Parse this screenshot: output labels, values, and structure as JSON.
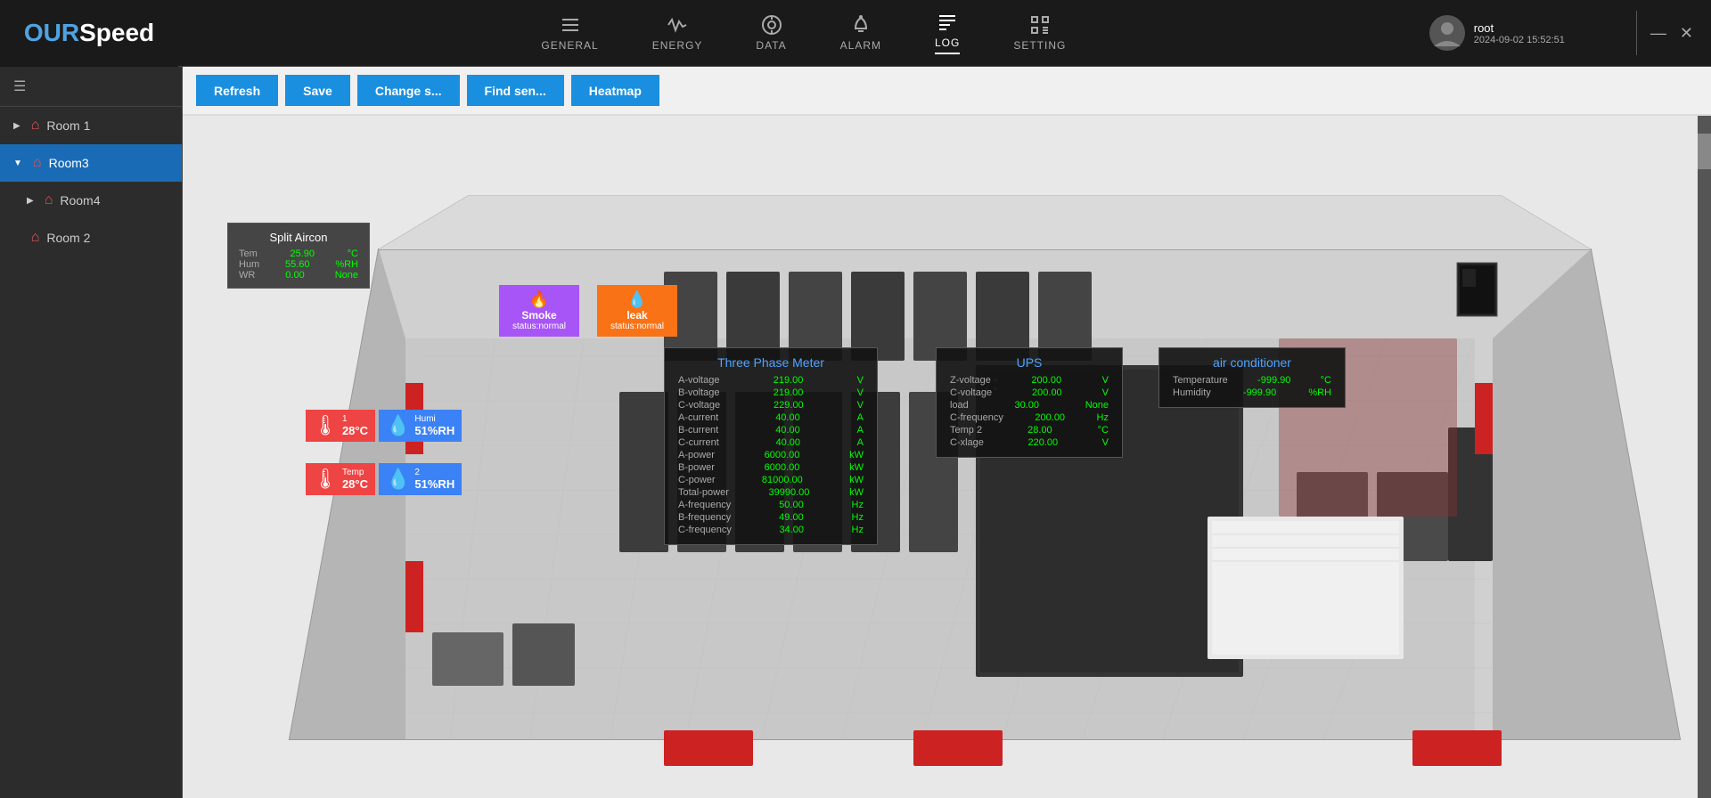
{
  "app": {
    "logo_our": "OUR",
    "logo_speed": "Speed",
    "datetime": "2024-09-02 15:52:51",
    "username": "root"
  },
  "nav": {
    "items": [
      {
        "id": "general",
        "label": "GENERAL",
        "icon": "list"
      },
      {
        "id": "energy",
        "label": "ENERGY",
        "icon": "wave"
      },
      {
        "id": "data",
        "label": "DATA",
        "icon": "target"
      },
      {
        "id": "alarm",
        "label": "ALARM",
        "icon": "bell"
      },
      {
        "id": "log",
        "label": "LOG",
        "icon": "lines",
        "active": true
      },
      {
        "id": "setting",
        "label": "SETTING",
        "icon": "sliders"
      }
    ]
  },
  "sidebar": {
    "items": [
      {
        "id": "room1",
        "label": "Room 1",
        "active": false,
        "expanded": false
      },
      {
        "id": "room3",
        "label": "Room3",
        "active": true,
        "expanded": true
      },
      {
        "id": "room4",
        "label": "Room4",
        "active": false,
        "expanded": false
      },
      {
        "id": "room2",
        "label": "Room 2",
        "active": false,
        "expanded": false
      }
    ]
  },
  "toolbar": {
    "buttons": [
      {
        "id": "refresh",
        "label": "Refresh"
      },
      {
        "id": "save",
        "label": "Save"
      },
      {
        "id": "change-s",
        "label": "Change s..."
      },
      {
        "id": "find-sen",
        "label": "Find sen..."
      },
      {
        "id": "heatmap",
        "label": "Heatmap"
      }
    ]
  },
  "widgets": {
    "split_aircon": {
      "title": "Split Aircon",
      "rows": [
        {
          "label": "Tem",
          "value": "25.90",
          "unit": "°C"
        },
        {
          "label": "Hum",
          "value": "55.60",
          "unit": "%RH"
        },
        {
          "label": "WR",
          "value": "0.00",
          "unit": "None"
        }
      ]
    },
    "smoke": {
      "label": "Smoke",
      "status": "status:normal"
    },
    "leak": {
      "label": "leak",
      "status": "status:normal"
    },
    "temp1": {
      "label": "1",
      "value": "28°C"
    },
    "humi1": {
      "label": "Humi",
      "value": "51%RH"
    },
    "temp2": {
      "label": "Temp",
      "value": "28°C"
    },
    "humi2": {
      "label": "2",
      "value": "51%RH"
    },
    "three_phase": {
      "title": "Three Phase Meter",
      "rows": [
        {
          "label": "A-voltage",
          "value": "219.00",
          "unit": "V"
        },
        {
          "label": "B-voltage",
          "value": "219.00",
          "unit": "V"
        },
        {
          "label": "C-voltage",
          "value": "229.00",
          "unit": "V"
        },
        {
          "label": "A-current",
          "value": "40.00",
          "unit": "A"
        },
        {
          "label": "B-current",
          "value": "40.00",
          "unit": "A"
        },
        {
          "label": "C-current",
          "value": "40.00",
          "unit": "A"
        },
        {
          "label": "A-power",
          "value": "6000.00",
          "unit": "kW"
        },
        {
          "label": "B-power",
          "value": "6000.00",
          "unit": "kW"
        },
        {
          "label": "C-power",
          "value": "81000.00",
          "unit": "kW"
        },
        {
          "label": "Total-power",
          "value": "39990.00",
          "unit": "kW"
        },
        {
          "label": "A-frequency",
          "value": "50.00",
          "unit": "Hz"
        },
        {
          "label": "B-frequency",
          "value": "49.00",
          "unit": "Hz"
        },
        {
          "label": "C-frequency",
          "value": "34.00",
          "unit": "Hz"
        }
      ]
    },
    "ups": {
      "title": "UPS",
      "rows": [
        {
          "label": "Z-voltage",
          "value": "200.00",
          "unit": "V"
        },
        {
          "label": "C-voltage",
          "value": "200.00",
          "unit": "V"
        },
        {
          "label": "load",
          "value": "30.00",
          "unit": "None"
        },
        {
          "label": "C-frequency",
          "value": "200.00",
          "unit": "Hz"
        },
        {
          "label": "Temp 2",
          "value": "28.00",
          "unit": "°C"
        },
        {
          "label": "C-xlage",
          "value": "220.00",
          "unit": "V"
        }
      ]
    },
    "air_conditioner": {
      "title": "air conditioner",
      "rows": [
        {
          "label": "Temperature",
          "value": "-999.90",
          "unit": "°C"
        },
        {
          "label": "Humidity",
          "value": "-999.90",
          "unit": "%RH"
        }
      ]
    }
  },
  "window_controls": {
    "minimize": "—",
    "close": "✕"
  }
}
